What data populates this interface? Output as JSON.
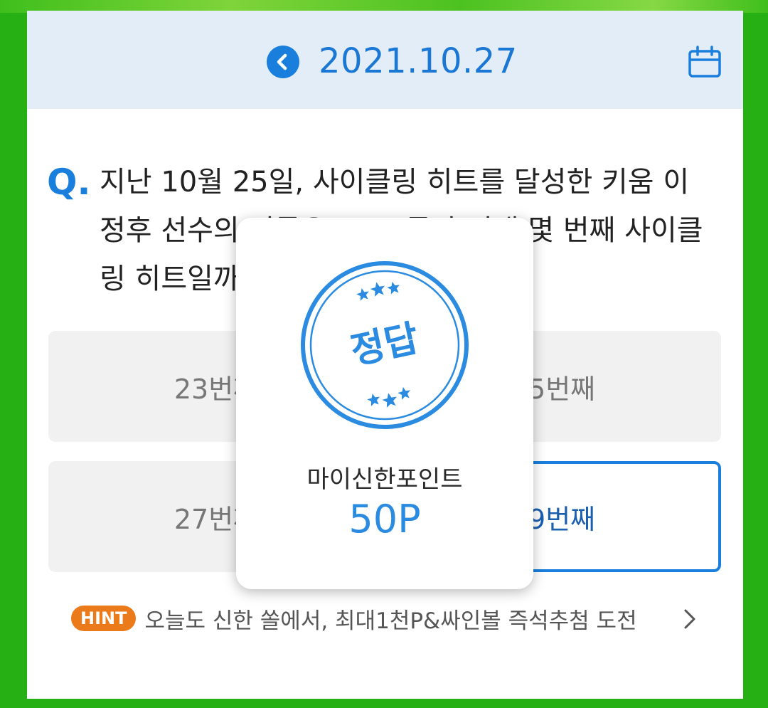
{
  "header": {
    "date": "2021.10.27",
    "back_icon": "chevron-left-icon",
    "calendar_icon": "calendar-icon"
  },
  "quiz": {
    "q_mark": "Q.",
    "question": "지난 10월 25일, 사이클링 히트를 달성한 키움 이정후 선수의 기록은 KBO 통산 역대 몇 번째 사이클링 히트일까요?",
    "answers": [
      {
        "label": "23번째"
      },
      {
        "label": "25번째"
      },
      {
        "label": "27번째"
      },
      {
        "label": "29번째",
        "selected": true
      }
    ]
  },
  "hint": {
    "badge": "HINT",
    "text": "오늘도 신한 쏠에서, 최대1천P&싸인볼 즉석추첨 도전",
    "chevron_icon": "chevron-right-icon"
  },
  "popup": {
    "stamp_text": "정답",
    "label": "마이신한포인트",
    "points": "50P"
  },
  "colors": {
    "accent": "#1a7fdc",
    "hint_badge": "#ea7a1a",
    "frame": "#27b014"
  }
}
